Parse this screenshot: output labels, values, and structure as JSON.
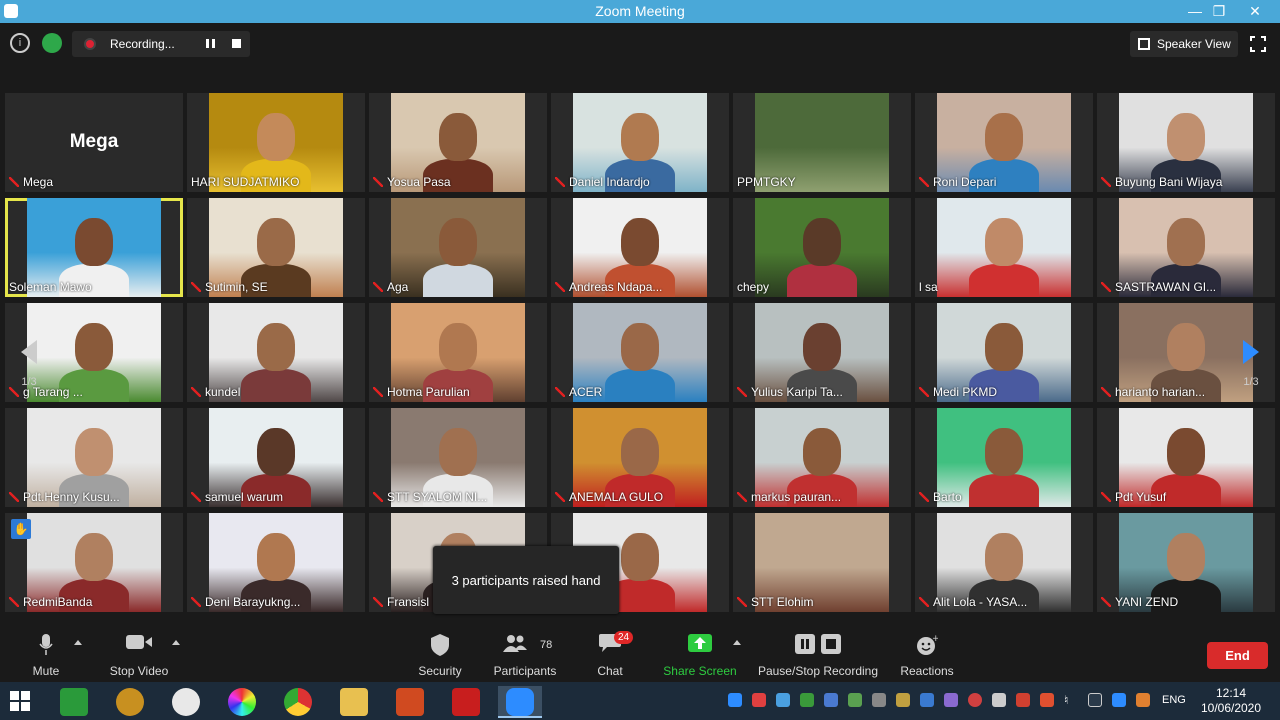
{
  "window": {
    "title": "Zoom Meeting"
  },
  "topbar": {
    "recording_label": "Recording...",
    "speaker_view_label": "Speaker View"
  },
  "tiles": [
    {
      "name": "Mega",
      "big": "Mega",
      "c1": "#2a2a2a",
      "c2": "#2a2a2a",
      "skin": "",
      "shirt": ""
    },
    {
      "name": "HARI SUDJATMIKO",
      "c1": "#b58a10",
      "c2": "#e8c030",
      "skin": "#c48a5a",
      "shirt": "#e3b81a"
    },
    {
      "name": "Yosua Pasa",
      "c1": "#d9c8b0",
      "c2": "#b89878",
      "skin": "#8a5a3a",
      "shirt": "#6b3020"
    },
    {
      "name": "Daniel Indardjo",
      "c1": "#d8e2e0",
      "c2": "#7fb3c8",
      "skin": "#b07a50",
      "shirt": "#3a6aa0"
    },
    {
      "name": "PPMTGKY",
      "c1": "#4d6a3a",
      "c2": "#8fa070",
      "skin": "",
      "shirt": ""
    },
    {
      "name": "Roni Depari",
      "c1": "#c8b0a0",
      "c2": "#6a8ab0",
      "skin": "#a8704a",
      "shirt": "#2e80c0"
    },
    {
      "name": "Buyung Bani Wijaya",
      "c1": "#e0e0e0",
      "c2": "#3a4050",
      "skin": "#c09070",
      "shirt": "#2a3040"
    },
    {
      "name": "Soleman Mawo",
      "active": true,
      "c1": "#3aa0d8",
      "c2": "#e8eef0",
      "skin": "#7a4a30",
      "shirt": "#f0f0f0"
    },
    {
      "name": "Sutimin, SE",
      "c1": "#e8e0d0",
      "c2": "#c08050",
      "skin": "#9a6a48",
      "shirt": "#5a3a20"
    },
    {
      "name": "Aga",
      "c1": "#8a7050",
      "c2": "#3a3020",
      "skin": "#8a5a3a",
      "shirt": "#d0d8e0"
    },
    {
      "name": "Andreas Ndapa...",
      "c1": "#f0f0f0",
      "c2": "#b05030",
      "skin": "#7a4a30",
      "shirt": "#c05030"
    },
    {
      "name": "chepy",
      "c1": "#4a7a30",
      "c2": "#2a3a20",
      "skin": "#5a3a28",
      "shirt": "#b03040"
    },
    {
      "name": "l sa",
      "c1": "#e0e8ec",
      "c2": "#c83030",
      "skin": "#c08a68",
      "shirt": "#d03030"
    },
    {
      "name": "SASTRAWAN GI...",
      "c1": "#d8c0b0",
      "c2": "#2a2a3a",
      "skin": "#a07050",
      "shirt": "#2a2a3a"
    },
    {
      "name": "g Tarang ...",
      "c1": "#f0f0f0",
      "c2": "#4a8a30",
      "skin": "#8a5a3a",
      "shirt": "#5a9a40"
    },
    {
      "name": "kundel",
      "c1": "#e8e8e8",
      "c2": "#504848",
      "skin": "#9a6a48",
      "shirt": "#7a3a3a"
    },
    {
      "name": "Hotma Parulian",
      "c1": "#d8a070",
      "c2": "#604030",
      "skin": "#b07850",
      "shirt": "#a04040"
    },
    {
      "name": "ACER",
      "c1": "#b0b8c0",
      "c2": "#2a80c0",
      "skin": "#9a6848",
      "shirt": "#2a80c0"
    },
    {
      "name": "Yulius Karipi Ta...",
      "c1": "#b8c0c0",
      "c2": "#6a5040",
      "skin": "#6a4030",
      "shirt": "#4a4a4a"
    },
    {
      "name": "Medi PKMD",
      "c1": "#d0d8d8",
      "c2": "#4a6a8a",
      "skin": "#8a5a3a",
      "shirt": "#4a5aa0"
    },
    {
      "name": "harianto harian...",
      "c1": "#8a7060",
      "c2": "#c0a080",
      "skin": "#b08060",
      "shirt": "#6a5040"
    },
    {
      "name": "Pdt.Henny Kusu...",
      "c1": "#e8e8e8",
      "c2": "#c0b0a0",
      "skin": "#c09070",
      "shirt": "#a0a0a0"
    },
    {
      "name": "samuel warum",
      "c1": "#e8eef0",
      "c2": "#3a3030",
      "skin": "#5a3828",
      "shirt": "#8a2a2a"
    },
    {
      "name": "STT SYALOM NI...",
      "c1": "#8a7a70",
      "c2": "#e8e8e8",
      "skin": "#a07050",
      "shirt": "#e8e8e8"
    },
    {
      "name": "ANEMALA GULO",
      "c1": "#d09030",
      "c2": "#c02020",
      "skin": "#9a6848",
      "shirt": "#c02a2a"
    },
    {
      "name": "markus pauran...",
      "c1": "#c8d0d0",
      "c2": "#c03030",
      "skin": "#8a5a3a",
      "shirt": "#c03030"
    },
    {
      "name": "Barto",
      "c1": "#40c080",
      "c2": "#e0e8e8",
      "skin": "#8a5a3a",
      "shirt": "#c03030"
    },
    {
      "name": "Pdt Yusuf",
      "c1": "#e8e8e8",
      "c2": "#c02a2a",
      "skin": "#7a4a30",
      "shirt": "#c02a2a"
    },
    {
      "name": "RedmiBanda",
      "hand": true,
      "c1": "#e0e0e0",
      "c2": "#8a2a2a",
      "skin": "#b08060",
      "shirt": "#8a2a2a"
    },
    {
      "name": "Deni Barayukng...",
      "c1": "#e8e8f0",
      "c2": "#3a2a2a",
      "skin": "#b07850",
      "shirt": "#3a2a2a"
    },
    {
      "name": "Fransisl",
      "c1": "#d8d0c8",
      "c2": "#2a2020",
      "skin": "#b08060",
      "shirt": "#2a2020"
    },
    {
      "name": "",
      "c1": "#e8e8e8",
      "c2": "#c02a2a",
      "skin": "#9a6848",
      "shirt": "#c02a2a"
    },
    {
      "name": "STT Elohim",
      "c1": "#c0a890",
      "c2": "#704030",
      "skin": "",
      "shirt": ""
    },
    {
      "name": "Alit Lola - YASA...",
      "c1": "#e0e0e0",
      "c2": "#303030",
      "skin": "#b08060",
      "shirt": "#303030"
    },
    {
      "name": "YANI ZEND",
      "c1": "#6a9aa0",
      "c2": "#2a3a40",
      "skin": "#b08060",
      "shirt": "#1a1a1a"
    }
  ],
  "pagination": {
    "left": "1/3",
    "right": "1/3"
  },
  "tooltip": "3 participants raised hand",
  "toolbar": {
    "mute": "Mute",
    "stop_video": "Stop Video",
    "security": "Security",
    "participants": "Participants",
    "participants_count": "78",
    "chat": "Chat",
    "chat_badge": "24",
    "share_screen": "Share Screen",
    "pause_stop_recording": "Pause/Stop Recording",
    "reactions": "Reactions",
    "end": "End"
  },
  "taskbar": {
    "lang": "ENG",
    "time": "12:14",
    "date": "10/06/2020"
  }
}
